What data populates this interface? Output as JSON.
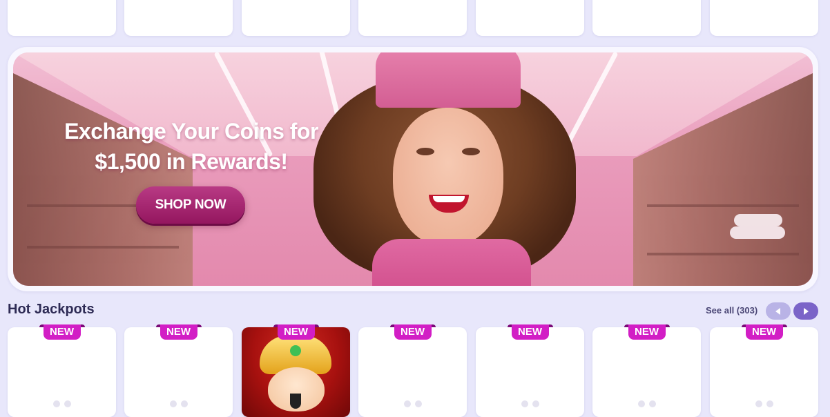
{
  "banner": {
    "headline_line1": "Exchange Your Coins for",
    "headline_line2": "$1,500 in Rewards!",
    "cta_label": "SHOP NOW",
    "accent_color": "#a8246f"
  },
  "hot_jackpots": {
    "title": "Hot Jackpots",
    "see_all_label": "See all (303)",
    "badge_label": "NEW",
    "badge_color": "#d21ec5",
    "nav_prev_icon": "chevron-left-icon",
    "nav_next_icon": "chevron-right-icon"
  }
}
